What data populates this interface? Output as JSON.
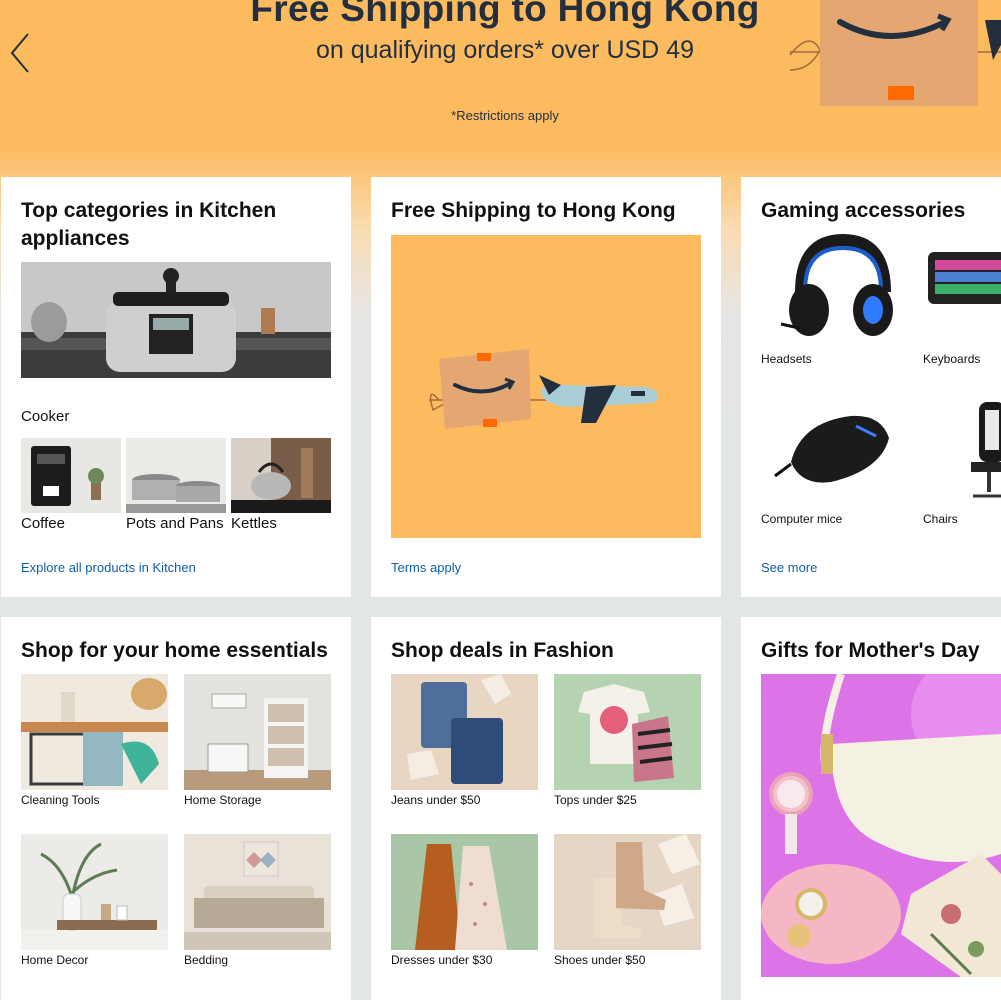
{
  "hero": {
    "title": "Free Shipping to Hong Kong",
    "subtitle": "on qualifying orders* over USD 49",
    "note": "*Restrictions apply"
  },
  "cards": {
    "kitchen": {
      "title": "Top categories in Kitchen appliances",
      "main_label": "Cooker",
      "items": [
        "Coffee",
        "Pots and Pans",
        "Kettles"
      ],
      "link": "Explore all products in Kitchen"
    },
    "shipping": {
      "title": "Free Shipping to Hong Kong",
      "link": "Terms apply"
    },
    "gaming": {
      "title": "Gaming accessories",
      "items": [
        "Headsets",
        "Keyboards",
        "Computer mice",
        "Chairs"
      ],
      "link": "See more"
    },
    "home": {
      "title": "Shop for your home essentials",
      "items": [
        "Cleaning Tools",
        "Home Storage",
        "Home Decor",
        "Bedding"
      ]
    },
    "fashion": {
      "title": "Shop deals in Fashion",
      "items": [
        "Jeans under $50",
        "Tops under $25",
        "Dresses under $30",
        "Shoes under $50"
      ]
    },
    "mothers": {
      "title": "Gifts for Mother's Day"
    }
  },
  "colors": {
    "accent_orange": "#fdbb60",
    "link_blue": "#0e5faa",
    "navy": "#232f3e"
  }
}
